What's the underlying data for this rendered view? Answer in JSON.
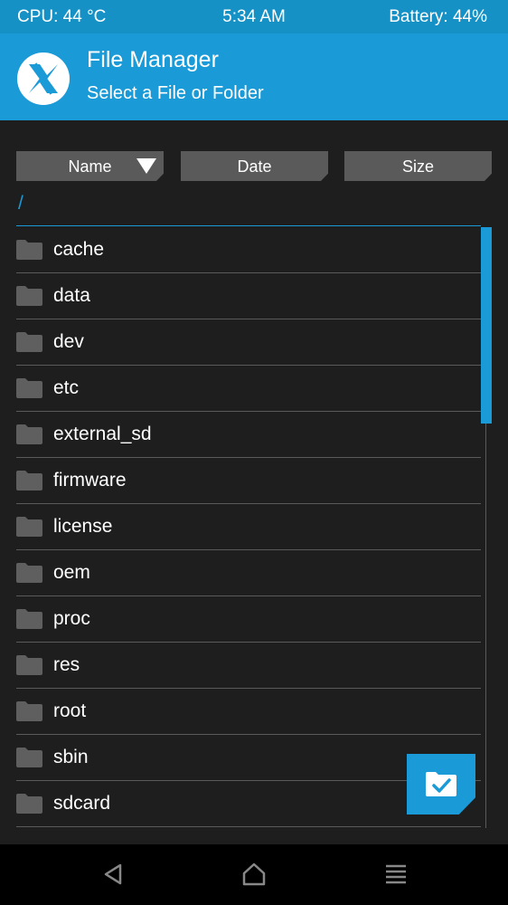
{
  "status_bar": {
    "cpu": "CPU: 44 °C",
    "time": "5:34 AM",
    "battery": "Battery: 44%"
  },
  "header": {
    "title": "File Manager",
    "subtitle": "Select a File or Folder",
    "logo_icon": "twrp-logo-icon"
  },
  "sort": {
    "name_label": "Name",
    "date_label": "Date",
    "size_label": "Size",
    "active": "Name"
  },
  "current_path": "/",
  "files": [
    {
      "name": "cache",
      "icon": "folder-icon"
    },
    {
      "name": "data",
      "icon": "folder-icon"
    },
    {
      "name": "dev",
      "icon": "folder-icon"
    },
    {
      "name": "etc",
      "icon": "folder-icon"
    },
    {
      "name": "external_sd",
      "icon": "folder-icon"
    },
    {
      "name": "firmware",
      "icon": "folder-icon"
    },
    {
      "name": "license",
      "icon": "folder-icon"
    },
    {
      "name": "oem",
      "icon": "folder-icon"
    },
    {
      "name": "proc",
      "icon": "folder-icon"
    },
    {
      "name": "res",
      "icon": "folder-icon"
    },
    {
      "name": "root",
      "icon": "folder-icon"
    },
    {
      "name": "sbin",
      "icon": "folder-icon"
    },
    {
      "name": "sdcard",
      "icon": "folder-icon"
    }
  ],
  "fab": {
    "icon": "folder-check-icon"
  },
  "nav": {
    "back_icon": "back-icon",
    "home_icon": "home-icon",
    "menu_icon": "menu-icon"
  },
  "colors": {
    "accent": "#1a9ad6",
    "status_bar": "#1591c6",
    "background": "#1e1e1e",
    "button": "#5a5a5a"
  }
}
